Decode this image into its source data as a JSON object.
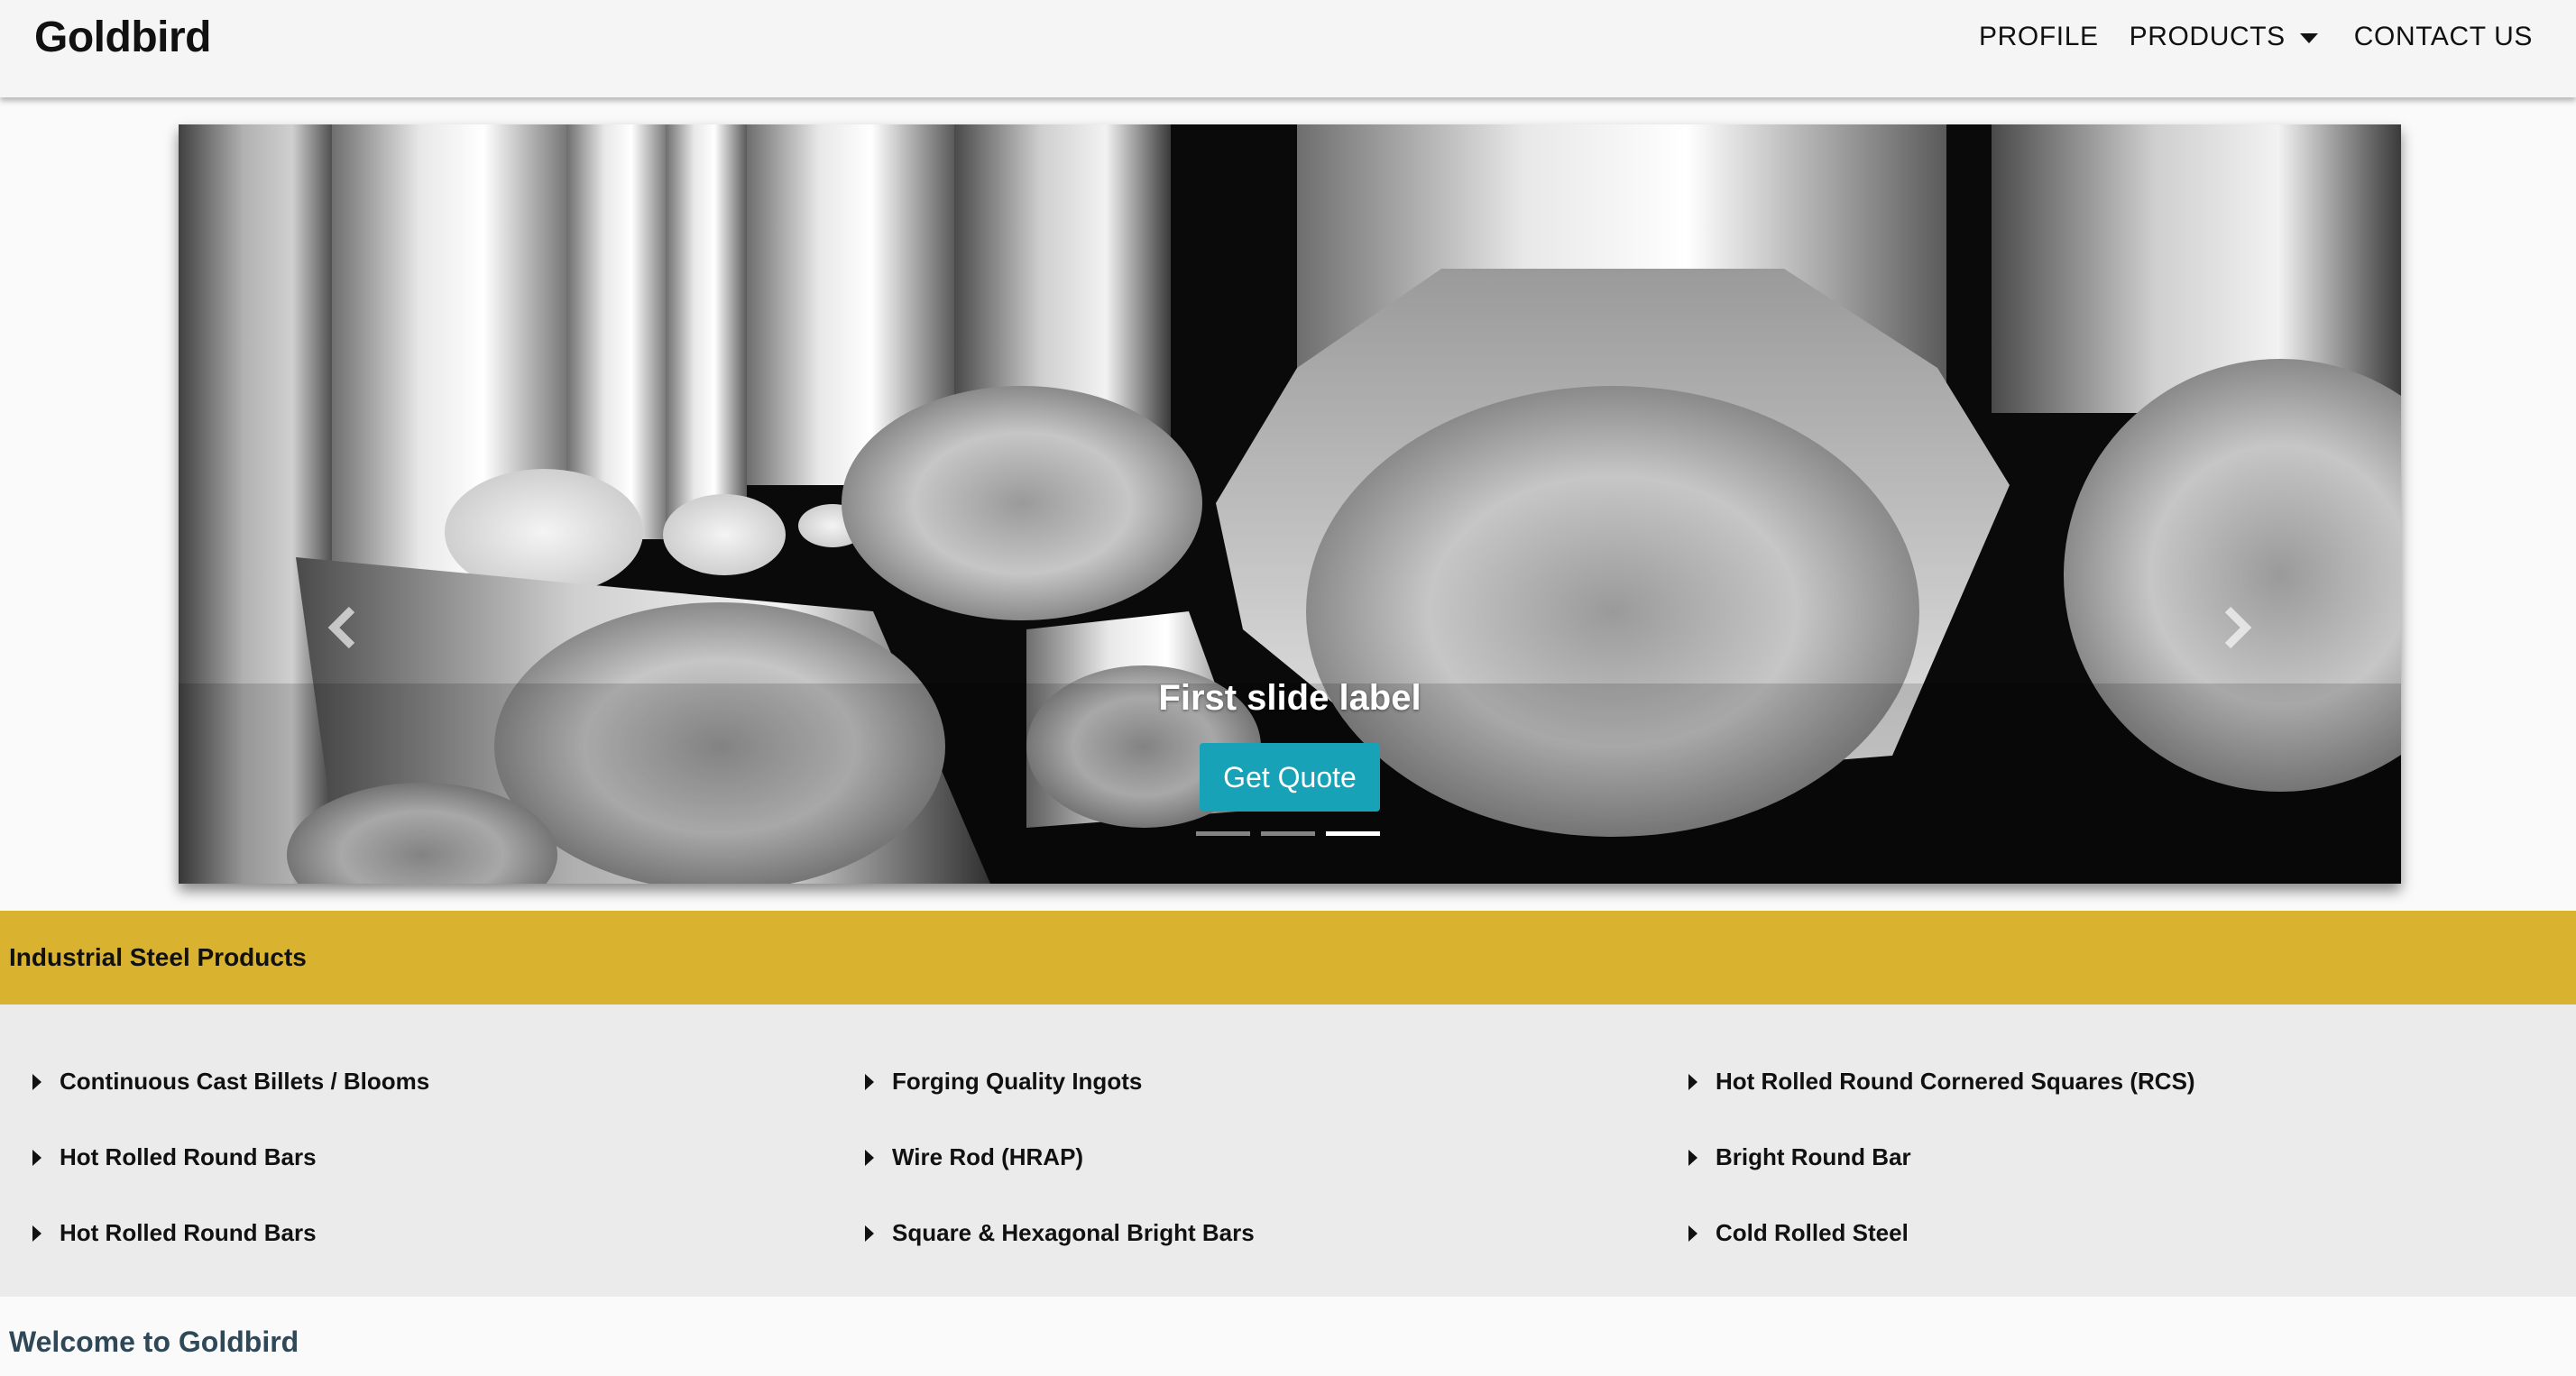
{
  "navbar": {
    "brand": "Goldbird",
    "links": [
      {
        "label": "PROFILE"
      },
      {
        "label": "PRODUCTS",
        "has_dropdown": true
      },
      {
        "label": "CONTACT US"
      }
    ]
  },
  "carousel": {
    "caption": "First slide label",
    "button_label": "Get Quote",
    "slide_count": 3,
    "active_slide": 3,
    "prev_icon": "chevron-left-icon",
    "next_icon": "chevron-right-icon"
  },
  "section": {
    "title": "Industrial Steel Products"
  },
  "products": [
    [
      "Continuous Cast Billets / Blooms",
      "Hot Rolled Round Bars",
      "Hot Rolled Round Bars"
    ],
    [
      "Forging Quality Ingots",
      "Wire Rod (HRAP)",
      "Square & Hexagonal Bright Bars"
    ],
    [
      "Hot Rolled Round Cornered Squares (RCS)",
      "Bright Round Bar",
      "Cold Rolled Steel"
    ]
  ],
  "welcome": {
    "heading": "Welcome to Goldbird"
  },
  "colors": {
    "accent_yellow": "#d9b230",
    "button_teal": "#17a2b8",
    "heading_slate": "#2f4858"
  }
}
